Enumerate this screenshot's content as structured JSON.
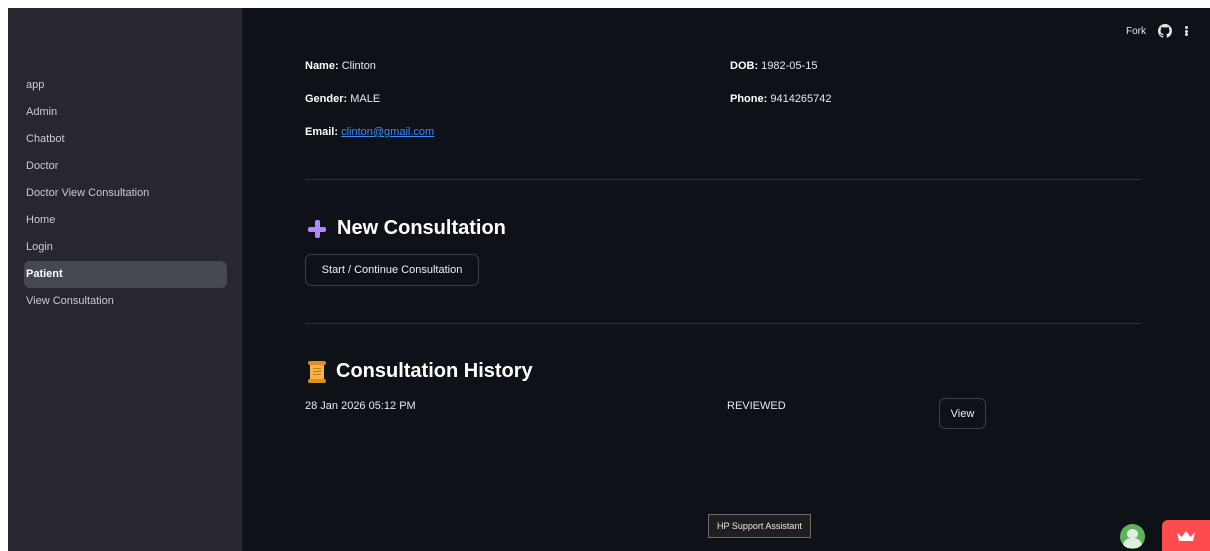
{
  "header": {
    "fork_label": "Fork",
    "github_icon": "github-icon",
    "menu_icon": "more-vertical-icon"
  },
  "sidebar": {
    "items": [
      {
        "label": "app",
        "active": false
      },
      {
        "label": "Admin",
        "active": false
      },
      {
        "label": "Chatbot",
        "active": false
      },
      {
        "label": "Doctor",
        "active": false
      },
      {
        "label": "Doctor View Consultation",
        "active": false
      },
      {
        "label": "Home",
        "active": false
      },
      {
        "label": "Login",
        "active": false
      },
      {
        "label": "Patient",
        "active": true
      },
      {
        "label": "View Consultation",
        "active": false
      }
    ]
  },
  "profile": {
    "name_label": "Name:",
    "name_value": "Clinton",
    "dob_label": "DOB:",
    "dob_value": "1982-05-15",
    "gender_label": "Gender:",
    "gender_value": "MALE",
    "phone_label": "Phone:",
    "phone_value": "9414265742",
    "email_label": "Email:",
    "email_value": "clinton@gmail.com"
  },
  "new_consultation": {
    "title": "New Consultation",
    "icon": "plus-icon",
    "button_label": "Start / Continue Consultation"
  },
  "history": {
    "title": "Consultation History",
    "icon": "scroll-icon",
    "rows": [
      {
        "date": "28 Jan 2026 05:12 PM",
        "status": "REVIEWED",
        "action_label": "View"
      }
    ]
  },
  "overlay": {
    "tooltip": "HP Support Assistant"
  },
  "colors": {
    "background": "#0e1117",
    "sidebar": "#262730",
    "accent_plus": "#b289ff",
    "link": "#3d8bff",
    "badge": "#ff4b4b"
  }
}
